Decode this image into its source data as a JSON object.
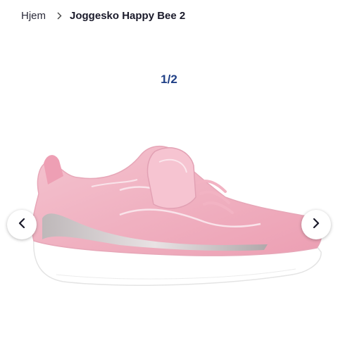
{
  "breadcrumb": {
    "home_label": "Hjem",
    "separator_icon": "chevron-right-icon",
    "current_label": "Joggesko Happy Bee 2"
  },
  "gallery": {
    "counter": "1/2",
    "prev_icon": "chevron-left-icon",
    "next_icon": "chevron-right-icon"
  },
  "colors": {
    "counter": "#1f3f86",
    "shoe_upper": "#f0b7c6",
    "sole": "#ffffff"
  }
}
